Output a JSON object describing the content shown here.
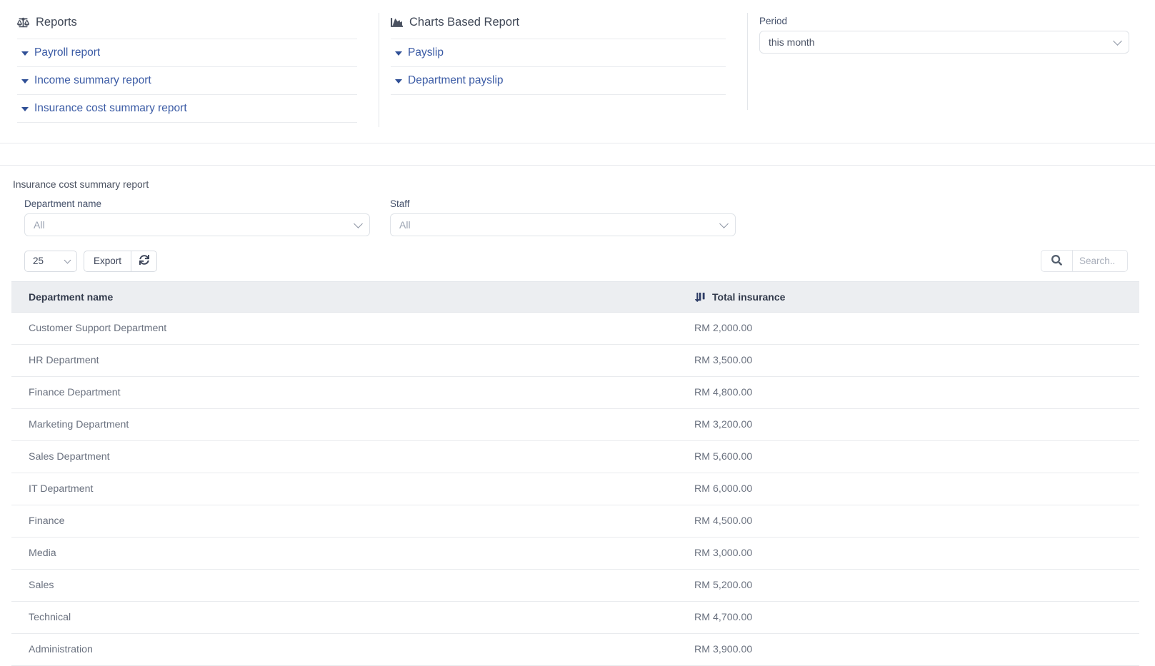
{
  "reports_panel": {
    "heading": "Reports",
    "heading_icon": "balance-scale-icon",
    "links": [
      {
        "label": "Payroll report"
      },
      {
        "label": "Income summary report"
      },
      {
        "label": "Insurance cost summary report"
      }
    ]
  },
  "charts_panel": {
    "heading": "Charts Based Report",
    "heading_icon": "chart-area-icon",
    "links": [
      {
        "label": "Payslip"
      },
      {
        "label": "Department payslip"
      }
    ]
  },
  "period_panel": {
    "label": "Period",
    "value": "this month",
    "chevron_icon": "chevron-down-icon"
  },
  "report": {
    "title": "Insurance cost summary report",
    "filters": [
      {
        "label": "Department name",
        "value": "All",
        "name": "department-name-select"
      },
      {
        "label": "Staff",
        "value": "All",
        "name": "staff-select"
      }
    ],
    "toolbar": {
      "page_size": "25",
      "export_label": "Export",
      "refresh_icon": "refresh-icon",
      "search_icon": "search-icon",
      "search_value": "",
      "search_placeholder": "Search.."
    },
    "table": {
      "columns": [
        {
          "label": "Department name",
          "sort_icon": null
        },
        {
          "label": "Total insurance",
          "sort_icon": "sort-amount-down-icon"
        }
      ],
      "rows": [
        {
          "department": "Customer Support Department",
          "total_insurance": "RM 2,000.00"
        },
        {
          "department": "HR Department",
          "total_insurance": "RM 3,500.00"
        },
        {
          "department": "Finance Department",
          "total_insurance": "RM 4,800.00"
        },
        {
          "department": "Marketing Department",
          "total_insurance": "RM 3,200.00"
        },
        {
          "department": "Sales Department",
          "total_insurance": "RM 5,600.00"
        },
        {
          "department": "IT Department",
          "total_insurance": "RM 6,000.00"
        },
        {
          "department": "Finance",
          "total_insurance": "RM 4,500.00"
        },
        {
          "department": "Media",
          "total_insurance": "RM 3,000.00"
        },
        {
          "department": "Sales",
          "total_insurance": "RM 5,200.00"
        },
        {
          "department": "Technical",
          "total_insurance": "RM 4,700.00"
        },
        {
          "department": "Administration",
          "total_insurance": "RM 3,900.00"
        }
      ]
    }
  }
}
